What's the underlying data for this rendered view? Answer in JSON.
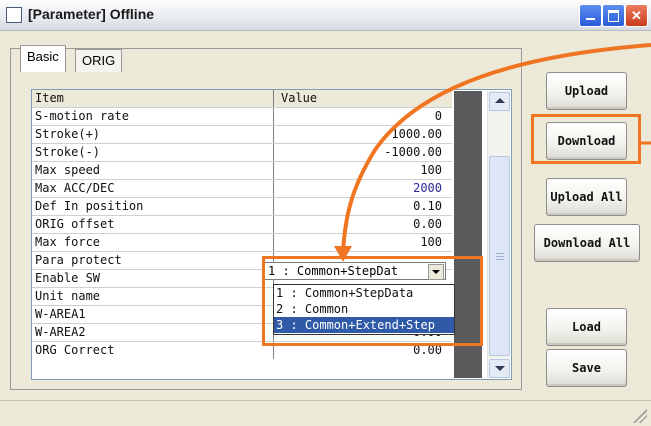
{
  "window": {
    "title": "[Parameter] Offline"
  },
  "tabs": [
    {
      "label": "Basic"
    },
    {
      "label": "ORIG"
    }
  ],
  "grid": {
    "header": {
      "item": "Item",
      "value": "Value"
    },
    "rows": [
      {
        "item": "S-motion rate",
        "value": "0"
      },
      {
        "item": "Stroke(+)",
        "value": "1000.00"
      },
      {
        "item": "Stroke(-)",
        "value": "-1000.00"
      },
      {
        "item": "Max speed",
        "value": "100"
      },
      {
        "item": "Max ACC/DEC",
        "value": "2000"
      },
      {
        "item": "Def In position",
        "value": "0.10"
      },
      {
        "item": "ORIG offset",
        "value": "0.00"
      },
      {
        "item": "Max force",
        "value": "100"
      },
      {
        "item": "Para protect",
        "value": ""
      },
      {
        "item": "Enable SW",
        "value": ""
      },
      {
        "item": "Unit name",
        "value": ""
      },
      {
        "item": "W-AREA1",
        "value": ""
      },
      {
        "item": "W-AREA2",
        "value": "0.00"
      },
      {
        "item": "ORG Correct",
        "value": "0.00"
      }
    ],
    "value_highlight_color": "#2a2a9a"
  },
  "combo": {
    "selected": "1 : Common+StepDat",
    "options": [
      "1 : Common+StepData",
      "2 : Common",
      "3 : Common+Extend+Step"
    ]
  },
  "buttons": {
    "upload": "Upload",
    "download": "Download",
    "upload_all": "Upload All",
    "download_all": "Download All",
    "load": "Load",
    "save": "Save"
  },
  "colors": {
    "annotation": "#f07522",
    "selection": "#2f5aa8"
  }
}
